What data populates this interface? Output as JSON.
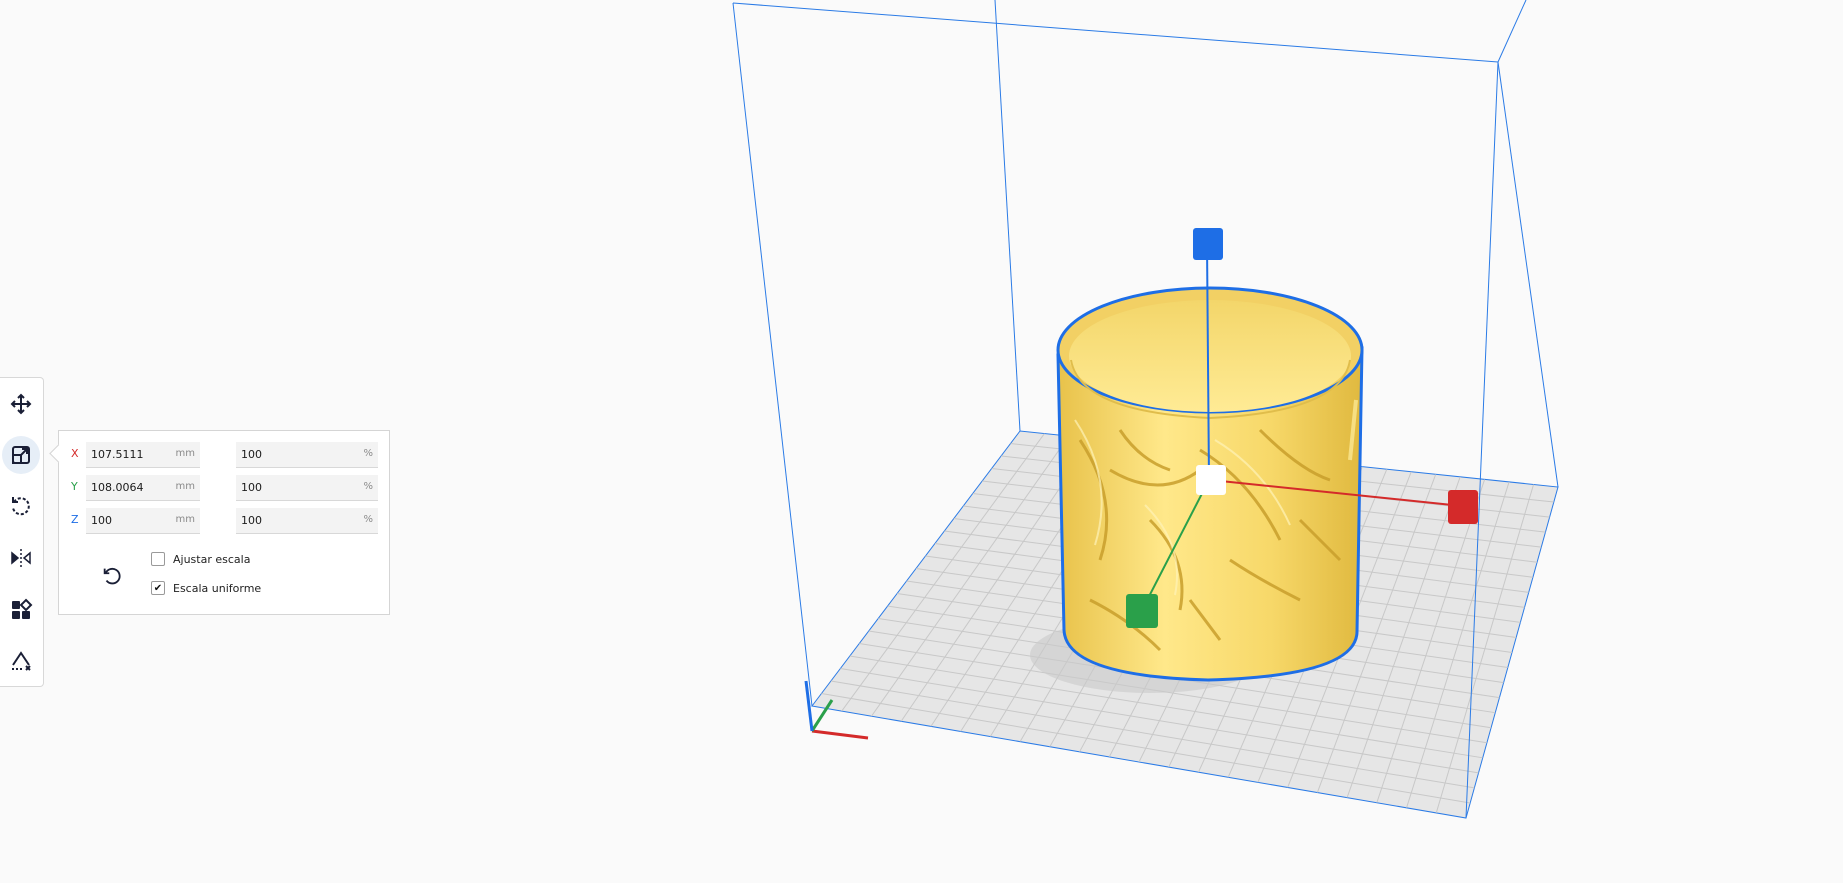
{
  "viewport": {
    "object_color": "#f5d96b",
    "outline_color": "#1e6ee6",
    "axis_colors": {
      "x": "#d42a2a",
      "y": "#2aa04a",
      "z": "#1e6ee6"
    }
  },
  "toolbar": {
    "tools": [
      {
        "name": "move-tool",
        "icon": "move-icon",
        "active": false
      },
      {
        "name": "scale-tool",
        "icon": "scale-icon",
        "active": true
      },
      {
        "name": "rotate-tool",
        "icon": "rotate-icon",
        "active": false
      },
      {
        "name": "mirror-tool",
        "icon": "mirror-icon",
        "active": false
      },
      {
        "name": "per-model-settings-tool",
        "icon": "per-model-settings-icon",
        "active": false
      },
      {
        "name": "support-blocker-tool",
        "icon": "support-blocker-icon",
        "active": false
      }
    ]
  },
  "scale_panel": {
    "x": {
      "axis": "X",
      "mm": "107.5111",
      "mm_unit": "mm",
      "percent": "100",
      "percent_unit": "%",
      "color": "#d42a2a"
    },
    "y": {
      "axis": "Y",
      "mm": "108.0064",
      "mm_unit": "mm",
      "percent": "100",
      "percent_unit": "%",
      "color": "#2aa04a"
    },
    "z": {
      "axis": "Z",
      "mm": "100",
      "mm_unit": "mm",
      "percent": "100",
      "percent_unit": "%",
      "color": "#1e6ee6"
    },
    "snap_scaling": {
      "label": "Ajustar escala",
      "checked": false
    },
    "uniform_scaling": {
      "label": "Escala uniforme",
      "checked": true
    },
    "reset_icon": "reset-icon"
  }
}
